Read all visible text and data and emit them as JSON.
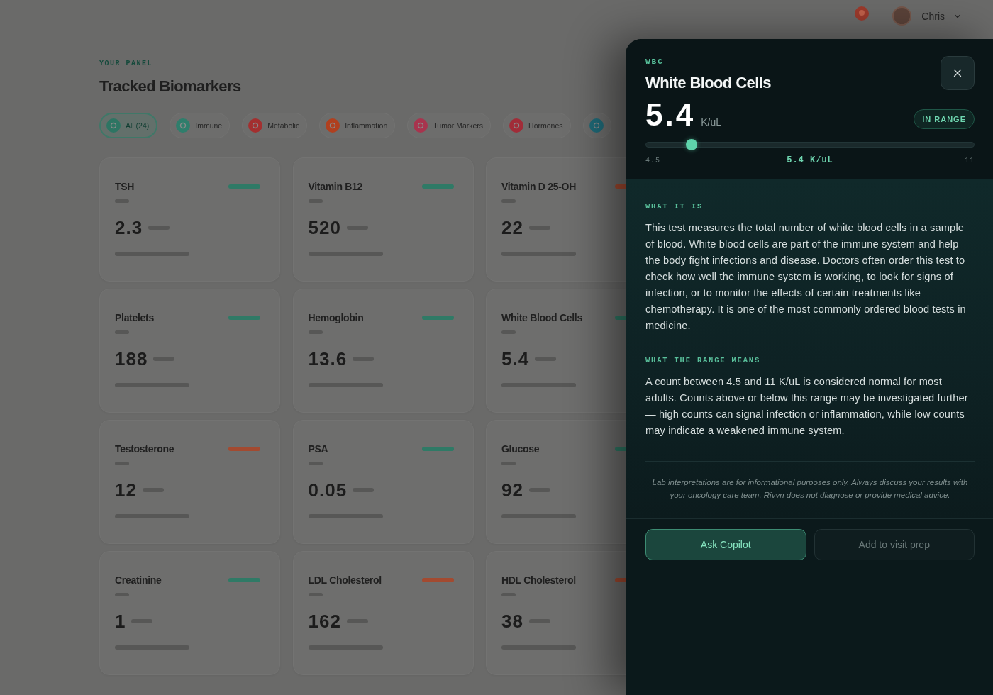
{
  "top_bar": {
    "user_name": "Chris"
  },
  "page": {
    "eyebrow": "YOUR PANEL",
    "title": "Tracked Biomarkers"
  },
  "filter_chips": [
    {
      "label": "All (24)",
      "color": "#2d7563",
      "selected": true
    },
    {
      "label": "Immune",
      "color": "#2f7e6c",
      "selected": false
    },
    {
      "label": "Metabolic",
      "color": "#a32f2f",
      "selected": false
    },
    {
      "label": "Inflammation",
      "color": "#b0401f",
      "selected": false
    },
    {
      "label": "Tumor Markers",
      "color": "#a8344e",
      "selected": false
    },
    {
      "label": "Hormones",
      "color": "#a12c38",
      "selected": false
    },
    {
      "color": "#1f6a78",
      "selected": false
    }
  ],
  "biomarker_cards": [
    {
      "name": "TSH",
      "value": "2.3",
      "flagged": false
    },
    {
      "name": "Vitamin B12",
      "value": "520",
      "flagged": false
    },
    {
      "name": "Vitamin D 25-OH",
      "value": "22",
      "flagged": true
    },
    {
      "name": "Platelets",
      "value": "188",
      "flagged": false
    },
    {
      "name": "Hemoglobin",
      "value": "13.6",
      "flagged": false
    },
    {
      "name": "White Blood Cells",
      "value": "5.4",
      "flagged": false
    },
    {
      "name": "Testosterone",
      "value": "12",
      "flagged": true
    },
    {
      "name": "PSA",
      "value": "0.05",
      "flagged": false
    },
    {
      "name": "Glucose",
      "value": "92",
      "flagged": false
    },
    {
      "name": "Creatinine",
      "value": "1",
      "flagged": false
    },
    {
      "name": "LDL Cholesterol",
      "value": "162",
      "flagged": true
    },
    {
      "name": "HDL Cholesterol",
      "value": "38",
      "flagged": true
    }
  ],
  "detail_panel": {
    "code": "WBC",
    "title": "White Blood Cells",
    "value": "5.4",
    "unit": "K/uL",
    "status": "IN RANGE",
    "range": {
      "min_label": "4.5",
      "reading": "5.4 K/uL",
      "max_label": "11",
      "level": 0.138
    },
    "sections": [
      {
        "heading": "WHAT IT IS",
        "body": "This test measures the total number of white blood cells in a sample of blood. White blood cells are part of the immune system and help the body fight infections and disease. Doctors often order this test to check how well the immune system is working, to look for signs of infection, or to monitor the effects of certain treatments like chemotherapy. It is one of the most commonly ordered blood tests in medicine."
      },
      {
        "heading": "WHAT THE RANGE MEANS",
        "body": "A count between 4.5 and 11 K/uL is considered normal for most adults. Counts above or below this range may be investigated further — high counts can signal infection or inflammation, while low counts may indicate a weakened immune system."
      }
    ],
    "disclaimer": "Lab interpretations are for informational purposes only. Always discuss your results with your oncology care team. Rivvn does not diagnose or provide medical advice.",
    "actions": [
      {
        "label": "Ask Copilot",
        "kind": "primary"
      },
      {
        "label": "Add to visit prep",
        "kind": "secondary"
      }
    ]
  }
}
